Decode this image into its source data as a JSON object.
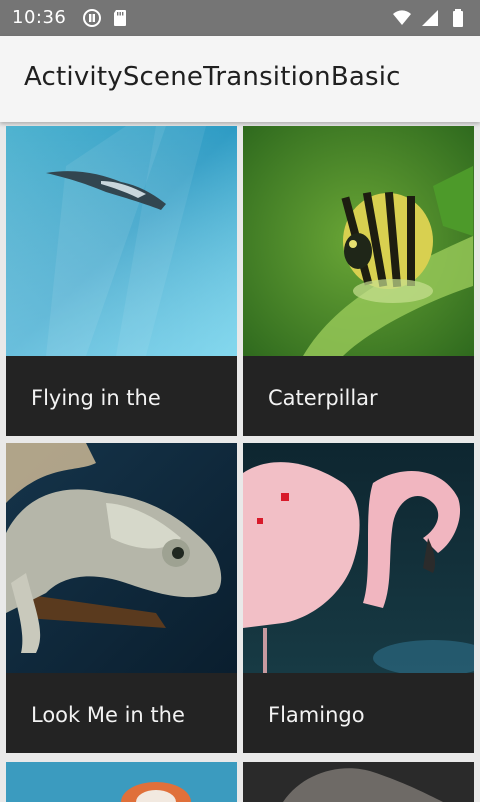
{
  "status_bar": {
    "time": "10:36",
    "icons_left": [
      "notification-icon",
      "sd-card-icon"
    ],
    "icons_right": [
      "wifi-icon",
      "cellular-signal-icon",
      "battery-icon"
    ]
  },
  "app_bar": {
    "title": "ActivitySceneTransitionBasic"
  },
  "grid": {
    "items": [
      {
        "caption": "Flying in the",
        "image": "flying-squirrel-photo"
      },
      {
        "caption": "Caterpillar",
        "image": "caterpillar-photo"
      },
      {
        "caption": "Look Me in the",
        "image": "chameleon-photo"
      },
      {
        "caption": "Flamingo",
        "image": "flamingo-photo"
      },
      {
        "caption": "",
        "image": "partial-photo-5"
      },
      {
        "caption": "",
        "image": "partial-photo-6"
      }
    ]
  },
  "colors": {
    "status_bar": "#757575",
    "app_bar": "#f5f5f5",
    "caption_bar": "#232323",
    "background": "#e9e9e9"
  }
}
